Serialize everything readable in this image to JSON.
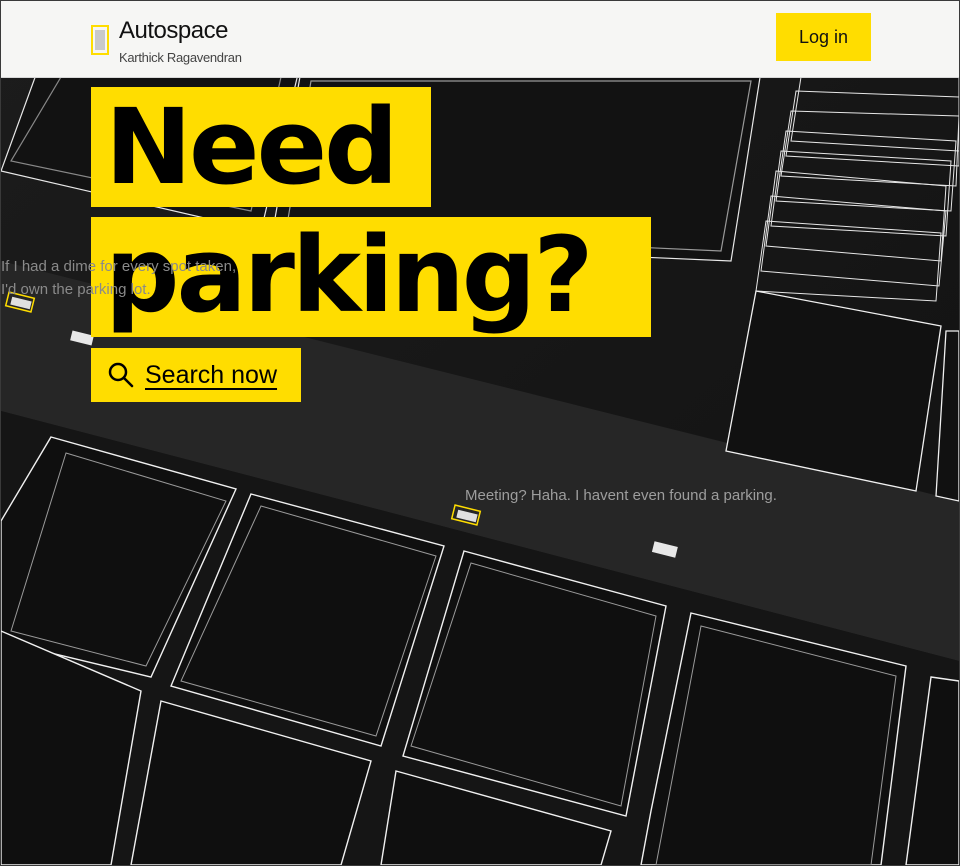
{
  "header": {
    "app_title": "Autospace",
    "subtitle": "Karthick Ragavendran",
    "login_label": "Log in"
  },
  "hero": {
    "line1": "Need",
    "line2": "parking?",
    "search_label": "Search now"
  },
  "messages": {
    "dime_line1": "If I had a dime for every spot taken,",
    "dime_line2": "I'd own the parking lot.",
    "meeting": "Meeting? Haha. I havent even found a parking."
  },
  "colors": {
    "accent": "#ffdd00",
    "background": "#141414",
    "header_bg": "#f6f6f4"
  },
  "icons": {
    "search": "search-icon",
    "logo": "logo-icon"
  }
}
